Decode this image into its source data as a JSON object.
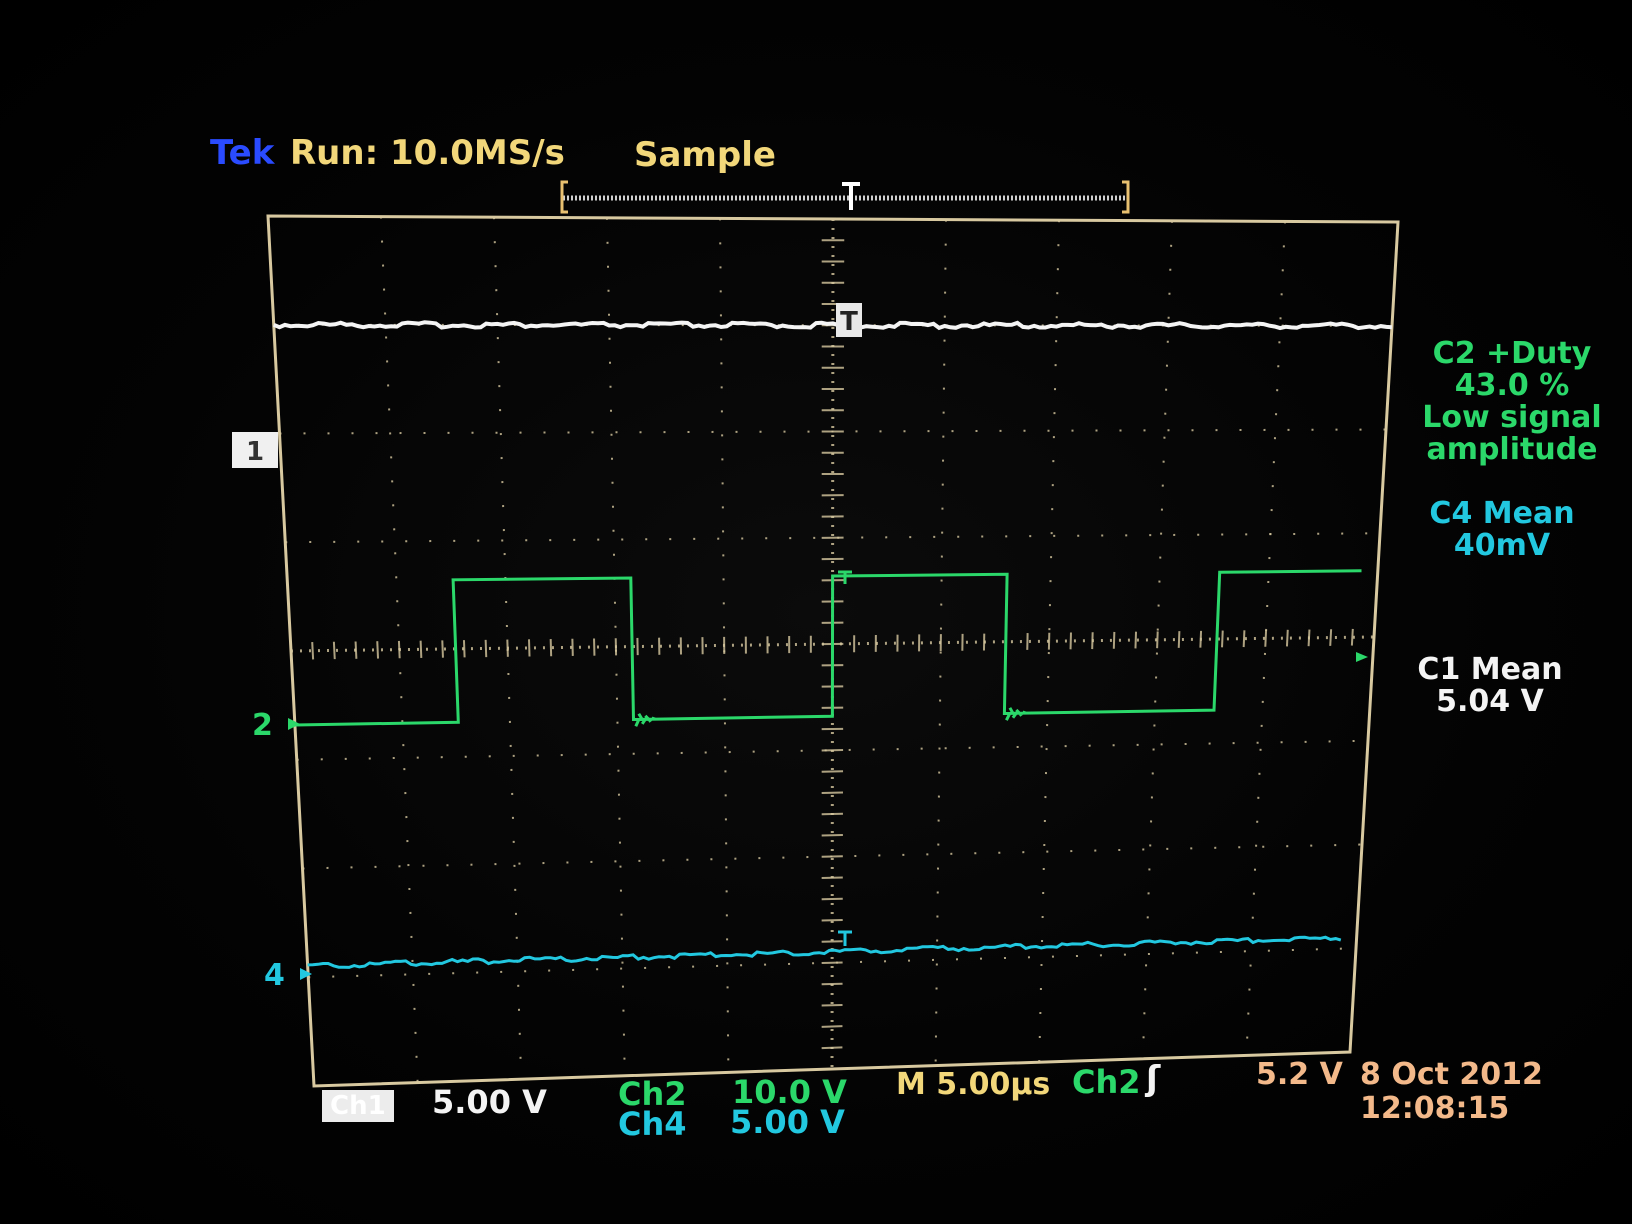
{
  "header": {
    "brand": "Tek",
    "run_status": "Run: 10.0MS/s",
    "acq_mode": "Sample"
  },
  "markers": {
    "trigger_pos": "T",
    "ch1": "1",
    "ch2": "2",
    "ch4": "4"
  },
  "measurements": {
    "m1_title": "C2 +Duty",
    "m1_value": "43.0 %",
    "m1_note_1": "Low signal",
    "m1_note_2": "amplitude",
    "m2_title": "C4 Mean",
    "m2_value": "40mV",
    "m3_title": "C1 Mean",
    "m3_value": "5.04 V"
  },
  "footer": {
    "ch1_label": "Ch1",
    "ch1_scale": "5.00 V",
    "ch2_label": "Ch2",
    "ch2_scale": "10.0 V",
    "ch4_label": "Ch4",
    "ch4_scale": "5.00 V",
    "timebase": "M 5.00µs",
    "trig_source": "Ch2",
    "trig_slope": "ʃ",
    "trig_level": "5.2 V",
    "date": "8 Oct 2012",
    "time": "12:08:15"
  },
  "colors": {
    "brand": "#2a4bff",
    "status": "#f2d77a",
    "ch1": "#f4f4f4",
    "ch2": "#2bd86a",
    "ch4": "#22c8e0",
    "graticule": "#d8c9a0",
    "trigger_text": "#f3b98a"
  }
}
